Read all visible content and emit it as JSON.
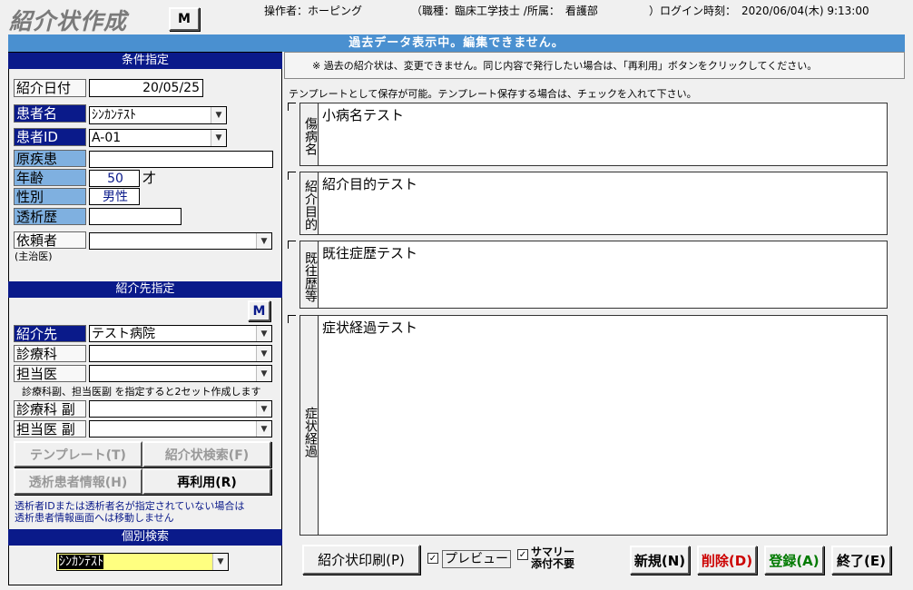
{
  "app": {
    "title": "紹介状作成",
    "m_label": "M"
  },
  "header": {
    "operator": "操作者：ホーピング",
    "job": "（職種：臨床工学技士 /所属：　看護部",
    "login_label": "）ログイン時刻：",
    "login_time": "2020/06/04(木) 9:13:00"
  },
  "banner": "過去データ表示中。編集できません。",
  "conditions": {
    "header": "条件指定",
    "date_label": "紹介日付",
    "date_value": "20/05/25",
    "patient_label": "患者名",
    "patient_value": "ｼﾝｶﾝﾃｽﾄ",
    "id_label": "患者ID",
    "id_value": "A-01",
    "disease_label": "原疾患",
    "age_label": "年齢",
    "age_value": "50",
    "age_unit": "才",
    "sex_label": "性別",
    "sex_value": "男性",
    "dialysis_label": "透析歴",
    "requester_label": "依頼者",
    "requester_sub": "(主治医)"
  },
  "destination": {
    "header": "紹介先指定",
    "m_label": "M",
    "dest_label": "紹介先",
    "dest_value": "テスト病院",
    "dept_label": "診療科",
    "doctor_label": "担当医",
    "note": "診療科副、担当医副 を指定すると2セット作成します",
    "dept2_label": "診療科 副",
    "doctor2_label": "担当医 副"
  },
  "buttons": {
    "template": "テンプレート(T)",
    "search": "紹介状検索(F)",
    "patient_info": "透析患者情報(H)",
    "reuse": "再利用(R)",
    "print": "紹介状印刷(P)",
    "preview": "プレビュー",
    "summary1": "サマリー",
    "summary2": "添付不要",
    "new": "新規(N)",
    "delete": "削除(D)",
    "register": "登録(A)",
    "end": "終了(E)"
  },
  "warning": [
    "透析者IDまたは透析者名が指定されていない場合は",
    "透析患者情報画面へは移動しません"
  ],
  "individual": {
    "header": "個別検索",
    "value": "ｼﾝｶﾝﾃｽﾄ"
  },
  "right": {
    "note": "※ 過去の紹介状は、変更できません。同じ内容で発行したい場合は、「再利用」ボタンをクリックしてください。",
    "template_note": "テンプレートとして保存が可能。テンプレート保存する場合は、チェックを入れて下さい。",
    "sections": [
      {
        "label": "傷病名",
        "text": "小病名テスト"
      },
      {
        "label": "紹介目的",
        "text": "紹介目的テスト"
      },
      {
        "label": "既往歴等",
        "text": "既往症歴テスト"
      },
      {
        "label": "症状経過",
        "text": "症状経過テスト"
      }
    ]
  },
  "colors": {
    "navy": "#0a1a8a",
    "banner": "#4a90d0",
    "label_blue": "#7fb0e0",
    "yellow": "#ffff80",
    "red": "#cc0000",
    "green": "#007a00"
  }
}
